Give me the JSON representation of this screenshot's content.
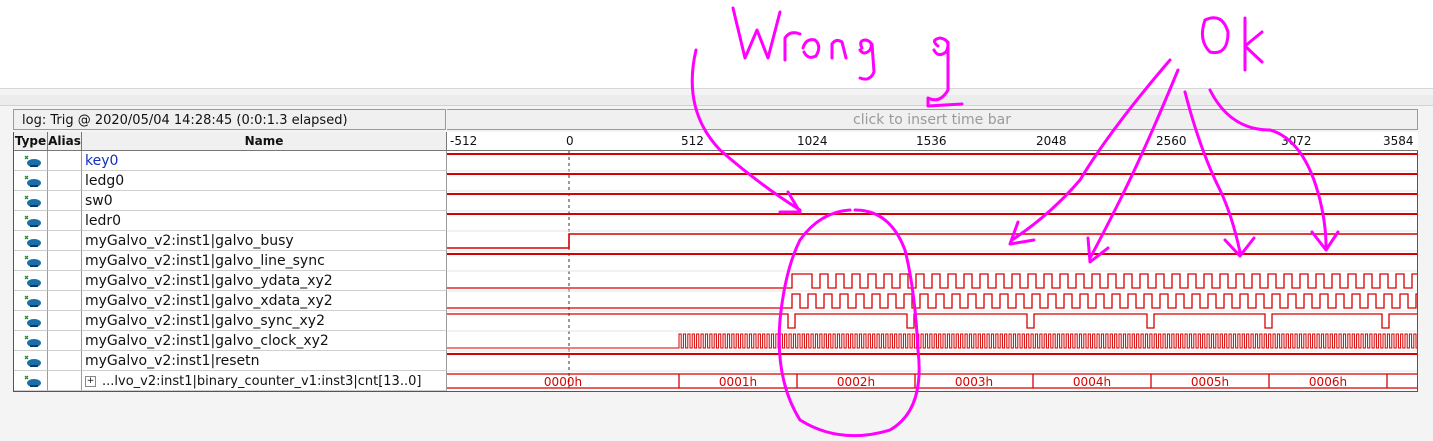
{
  "log_header": "log: Trig @ 2020/05/04 14:28:45 (0:0:1.3 elapsed)",
  "timebar_hint": "click to insert time bar",
  "columns": {
    "type": "Type",
    "alias": "Alias",
    "name": "Name"
  },
  "ruler_ticks": [
    "-512",
    "0",
    "512",
    "1024",
    "1536",
    "2048",
    "2560",
    "3072",
    "3584"
  ],
  "signals": [
    {
      "name": "key0",
      "highlighted": true
    },
    {
      "name": "ledg0"
    },
    {
      "name": "sw0"
    },
    {
      "name": "ledr0"
    },
    {
      "name": "myGalvo_v2:inst1|galvo_busy"
    },
    {
      "name": "myGalvo_v2:inst1|galvo_line_sync"
    },
    {
      "name": "myGalvo_v2:inst1|galvo_ydata_xy2"
    },
    {
      "name": "myGalvo_v2:inst1|galvo_xdata_xy2"
    },
    {
      "name": "myGalvo_v2:inst1|galvo_sync_xy2"
    },
    {
      "name": "myGalvo_v2:inst1|galvo_clock_xy2"
    },
    {
      "name": "myGalvo_v2:inst1|resetn"
    },
    {
      "name": "...lvo_v2:inst1|binary_counter_v1:inst3|cnt[13..0]",
      "expand": "+"
    }
  ],
  "bus_values": [
    "0000h",
    "0001h",
    "0002h",
    "0003h",
    "0004h",
    "0005h",
    "0006h"
  ],
  "annotations": {
    "wrong": "Wrong",
    "ok": "Ok"
  },
  "colors": {
    "wave": "#d60000",
    "annotation": "#ff00ff",
    "icon": "#1b6fa8"
  }
}
